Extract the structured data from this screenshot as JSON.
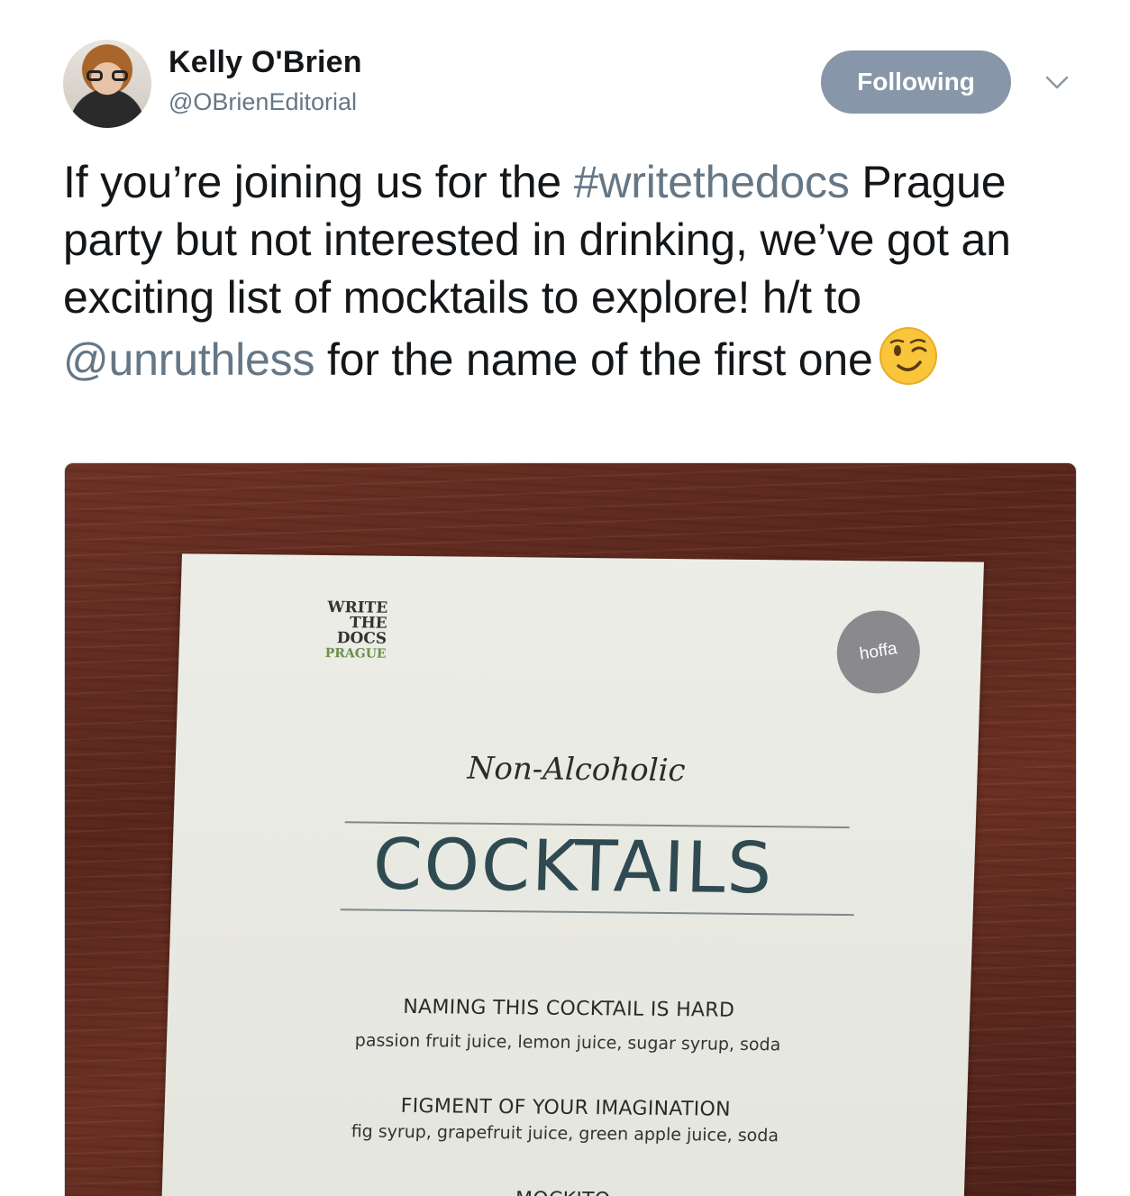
{
  "author": {
    "name": "Kelly O'Brien",
    "handle": "@OBrienEditorial"
  },
  "follow_button": {
    "label": "Following"
  },
  "tweet": {
    "text_part1": "If you’re joining us for the ",
    "hashtag": "#writethedocs",
    "text_part2": " Prague party but not interested in drinking, we’ve got an exciting list of mocktails to explore! h/t to ",
    "mention": "@unruthless",
    "text_part3": " for the name of the first one",
    "emoji": "winking-face"
  },
  "photo": {
    "logo_lines": [
      "WRITE",
      "THE",
      "DOCS",
      "PRAGUE"
    ],
    "sponsor_logo": "hoffa",
    "subtitle": "Non-Alcoholic",
    "heading": "COCKTAILS",
    "items": [
      {
        "name": "NAMING THIS COCKTAIL IS HARD",
        "ingredients": "passion fruit juice, lemon juice, sugar syrup, soda"
      },
      {
        "name": "FIGMENT OF YOUR IMAGINATION",
        "ingredients": "fig syrup, grapefruit juice, green apple juice, soda"
      },
      {
        "name": "MOCKITO",
        "ingredients": ""
      }
    ]
  },
  "colors": {
    "link": "#657786",
    "button_bg": "#8796a8",
    "text": "#14171a"
  }
}
